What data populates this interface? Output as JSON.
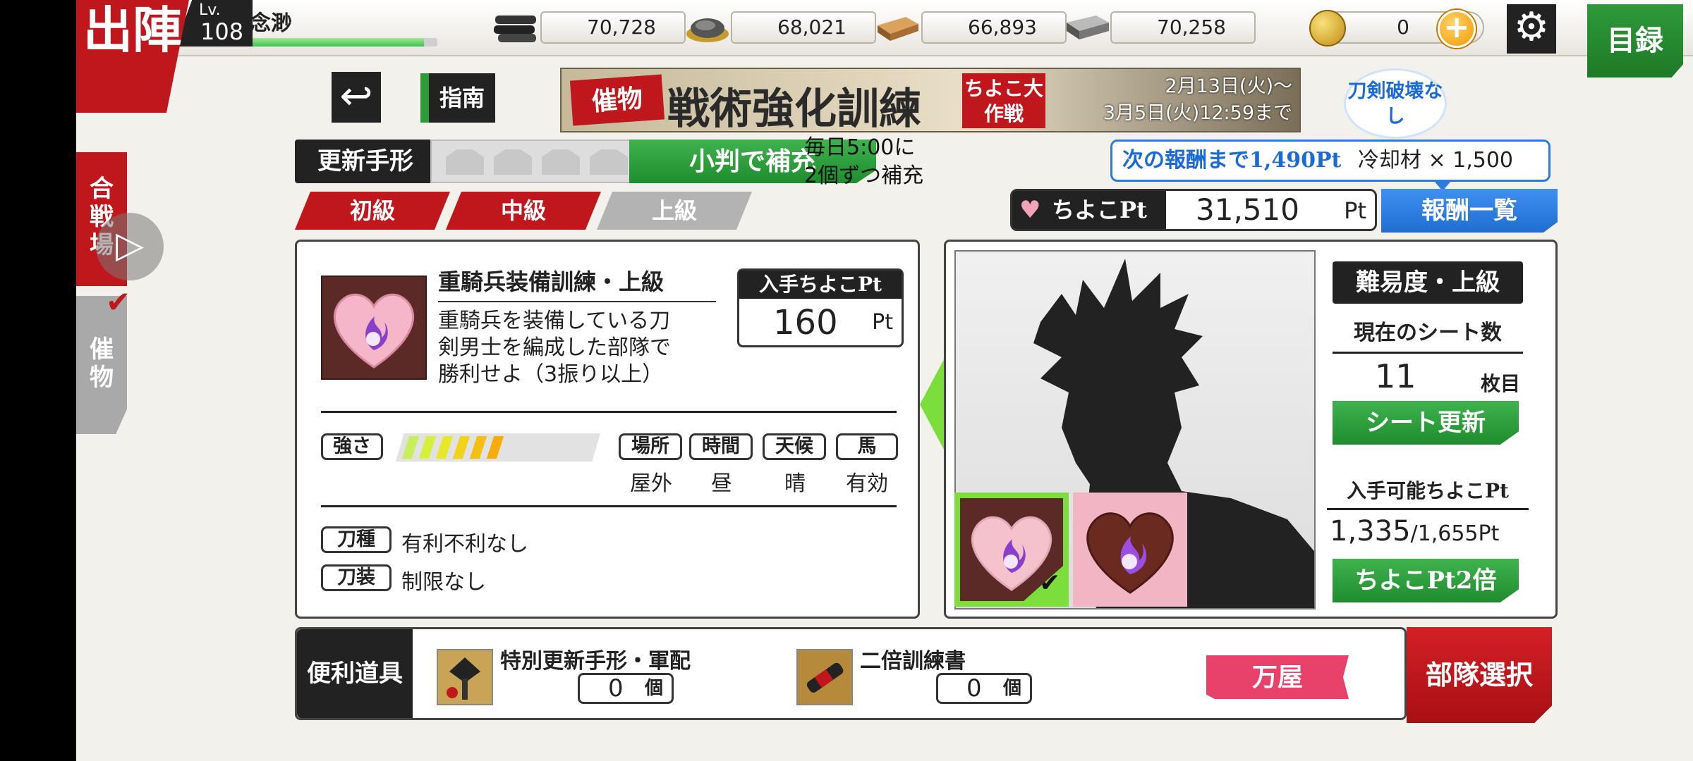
{
  "header": {
    "sortie_label": "出陣",
    "level_label": "Lv.",
    "level": "108",
    "player_name": "念渺",
    "exp_fraction": 0.93,
    "resources": [
      {
        "name": "charcoal-icon",
        "value": "70,728"
      },
      {
        "name": "steel-icon",
        "value": "68,021"
      },
      {
        "name": "coolant-icon",
        "value": "66,893"
      },
      {
        "name": "whetstone-icon",
        "value": "70,258"
      }
    ],
    "koban": "0",
    "catalog_label": "目録"
  },
  "side": {
    "arena_label": "合戦場",
    "event_label": "催物"
  },
  "event": {
    "guide_label": "指南",
    "banner_tag": "催物",
    "banner_title": "戦術強化訓練",
    "banner_sub": "ちよこ大作戦",
    "date_line1": "2月13日(火)〜",
    "date_line2": "3月5日(火)12:59まで",
    "no_break": "刀剣破壊なし"
  },
  "refresh": {
    "label": "更新手形",
    "refill_label": "小判で補充",
    "note_line1": "毎日5:00に",
    "note_line2": "2個ずつ補充"
  },
  "difficulty_tabs": [
    "初級",
    "中級",
    "上級"
  ],
  "reward": {
    "next_text": "次の報酬まで1,490Pt",
    "next_item": "冷却材 × 1,500",
    "pt_label": "ちよこPt",
    "pt_value": "31,510",
    "pt_unit": "Pt",
    "list_label": "報酬一覧"
  },
  "mission": {
    "title": "重騎兵装備訓練・上級",
    "desc_line1": "重騎兵を装備している刀",
    "desc_line2": "剣男士を編成した部隊で",
    "desc_line3": "勝利せよ（3振り以上）",
    "get_pt_label": "入手ちよこPt",
    "get_pt_value": "160",
    "get_pt_unit": "Pt",
    "strength_label": "強さ",
    "strength_level": 6,
    "conditions": [
      {
        "label": "場所",
        "value": "屋外"
      },
      {
        "label": "時間",
        "value": "昼"
      },
      {
        "label": "天候",
        "value": "晴"
      },
      {
        "label": "馬",
        "value": "有効"
      }
    ],
    "sword_type_label": "刀種",
    "sword_type_value": "有利不利なし",
    "equip_label": "刀装",
    "equip_value": "制限なし"
  },
  "sheet": {
    "difficulty": "難易度・上級",
    "count_label": "現在のシート数",
    "count": "11",
    "count_unit": "枚目",
    "renew_label": "シート更新",
    "avail_label": "入手可能ちよこPt",
    "avail_value": "1,335",
    "avail_total": "/1,655Pt",
    "double_label": "ちよこPt2倍"
  },
  "tools": {
    "label": "便利道具",
    "items": [
      {
        "name": "特別更新手形・軍配",
        "count": "0",
        "unit": "個"
      },
      {
        "name": "二倍訓練書",
        "count": "0",
        "unit": "個"
      }
    ],
    "shop_label": "万屋",
    "squad_label": "部隊選択"
  }
}
